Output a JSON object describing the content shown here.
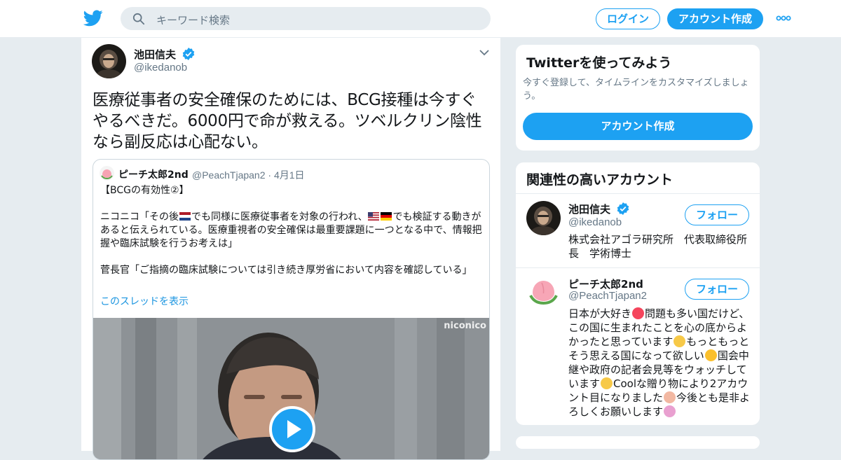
{
  "header": {
    "search_placeholder": "キーワード検索",
    "login_label": "ログイン",
    "signup_label": "アカウント作成",
    "brand_color": "#1da1f2"
  },
  "tweet": {
    "author_name": "池田信夫",
    "author_handle": "@ikedanob",
    "text": "医療従事者の安全確保のためには、BCG接種は今すぐやるべきだ。6000円で命が救える。ツベルクリン陰性なら副反応は心配ない。",
    "quote": {
      "author_name": "ピーチ太郎2nd",
      "author_handle": "@PeachTjapan2",
      "date": "4月1日",
      "line1": "【BCGの有効性②】",
      "line2a": "ニコニコ「その後",
      "line2b": "でも同様に医療従事者を対象の行われ、",
      "line2c": "でも検証する動きがあると伝えられている。医療重視者の安全確保は最重要課題に一つとなる中で、情報把握や臨床試験を行うお考えは」",
      "line3": "菅長官「ご指摘の臨床試験については引き続き厚労省において内容を確認している」",
      "thread_link": "このスレッドを表示",
      "video_watermark": "niconico"
    }
  },
  "signup_panel": {
    "title": "Twitterを使ってみよう",
    "description": "今すぐ登録して、タイムラインをカスタマイズしましょう。",
    "button_label": "アカウント作成"
  },
  "related_panel": {
    "title": "関連性の高いアカウント",
    "accounts": [
      {
        "name": "池田信夫",
        "handle": "@ikedanob",
        "follow_label": "フォロー",
        "bio": "株式会社アゴラ研究所　代表取締役所長　学術博士"
      },
      {
        "name": "ピーチ太郎2nd",
        "handle": "@PeachTjapan2",
        "follow_label": "フォロー",
        "bio1": "日本が大好き",
        "bio2": "問題も多い国だけど、この国に生まれたことを心の底からよかったと思っています",
        "bio3": "もっともっとそう思える国になって欲しい",
        "bio4": "国会中継や政府の記者会見等をウォッチしています",
        "bio5": "Coolな贈り物により2アカウント目になりました",
        "bio6": "今後とも是非よろしくお願いします"
      }
    ]
  }
}
